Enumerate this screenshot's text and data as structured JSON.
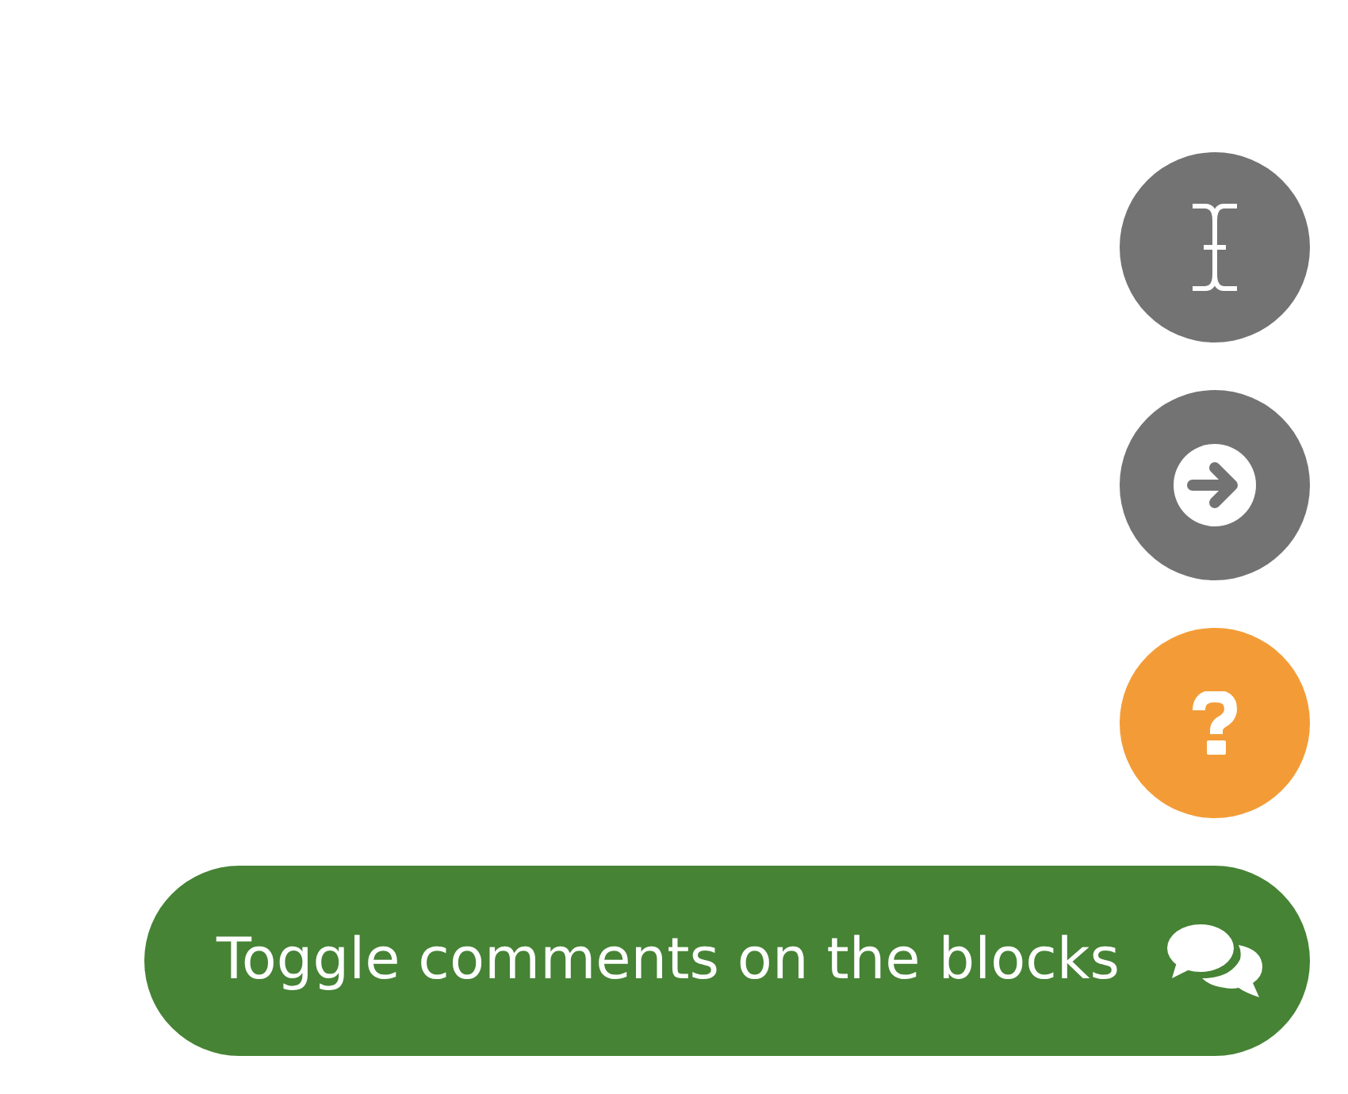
{
  "round_buttons": [
    {
      "kind": "cursor",
      "color": "#737373"
    },
    {
      "kind": "next",
      "color": "#737373"
    },
    {
      "kind": "help",
      "color": "#f39c37"
    }
  ],
  "toggle_button": {
    "label": "Toggle comments on the blocks",
    "color": "#468335"
  }
}
